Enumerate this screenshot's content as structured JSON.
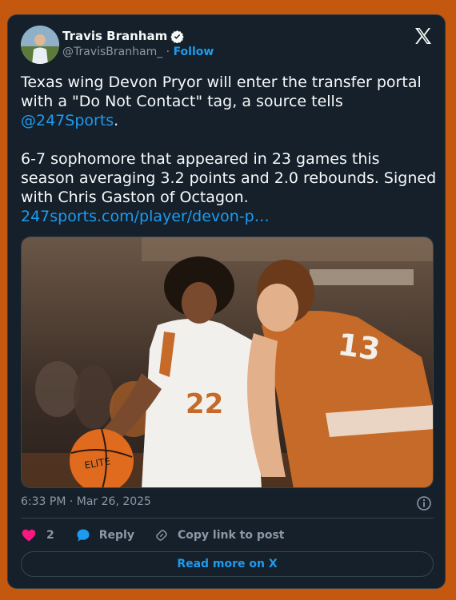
{
  "author": {
    "name": "Travis Branham",
    "handle": "@TravisBranham_",
    "separator": "·",
    "follow_label": "Follow"
  },
  "tweet": {
    "line1": "Texas wing Devon Pryor will enter the transfer portal with a \"Do Not Contact\" tag, a source tells ",
    "mention": "@247Sports",
    "line1_end": ".",
    "line2": "6-7 sophomore that appeared in 23 games this season averaging 3.2 points and 2.0 rebounds. Signed with Chris Gaston of Octagon.",
    "link": "247sports.com/player/devon-p…"
  },
  "photo": {
    "jersey_left": "22",
    "jersey_right": "13",
    "ball_text": "ELITE"
  },
  "timestamp": "6:33 PM · Mar 26, 2025",
  "actions": {
    "likes": "2",
    "reply_label": "Reply",
    "copy_label": "Copy link to post"
  },
  "read_more_label": "Read more on X",
  "colors": {
    "background": "#c4580f",
    "card": "#15202b",
    "accent": "#1d9bf0",
    "heart": "#f91880"
  },
  "icons": [
    "verified-badge-icon",
    "x-logo-icon",
    "info-icon",
    "heart-icon",
    "reply-bubble-icon",
    "link-icon"
  ]
}
